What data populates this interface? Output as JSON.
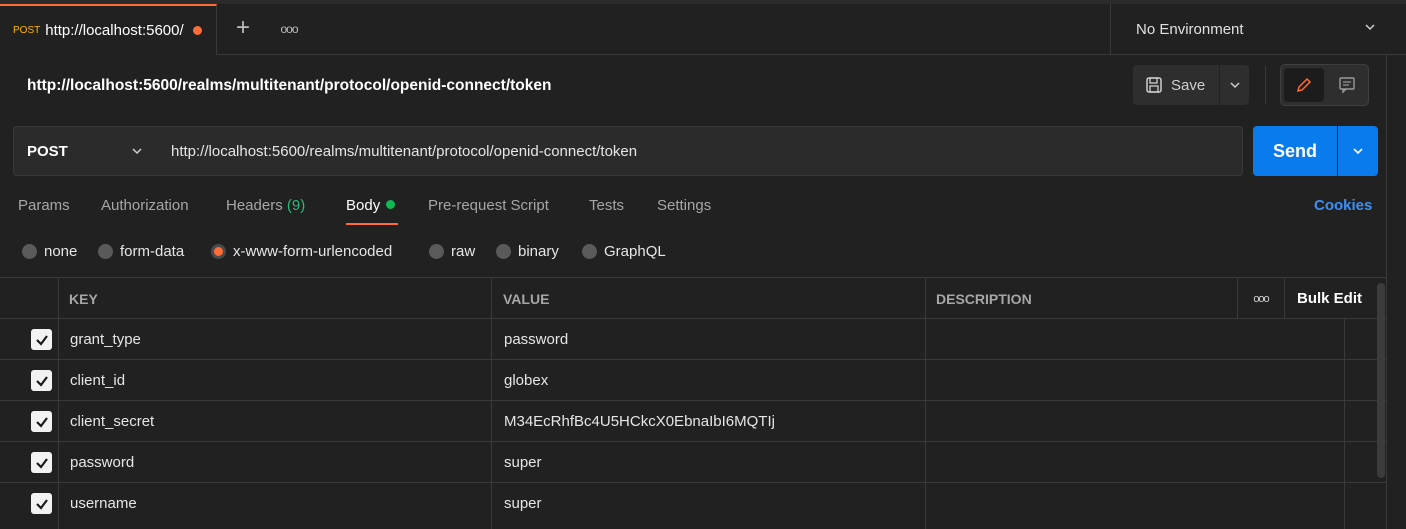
{
  "tab": {
    "method": "POST",
    "url": "http://localhost:5600/",
    "unsaved": true
  },
  "environment": {
    "label": "No Environment"
  },
  "request": {
    "title": "http://localhost:5600/realms/multitenant/protocol/openid-connect/token",
    "method": "POST",
    "url": "http://localhost:5600/realms/multitenant/protocol/openid-connect/token",
    "save_label": "Save",
    "send_label": "Send"
  },
  "request_tabs": {
    "params": "Params",
    "authorization": "Authorization",
    "headers": "Headers",
    "headers_count": "(9)",
    "body": "Body",
    "prerequest": "Pre-request Script",
    "tests": "Tests",
    "settings": "Settings",
    "cookies": "Cookies"
  },
  "body_types": {
    "none": "none",
    "form_data": "form-data",
    "urlencoded": "x-www-form-urlencoded",
    "raw": "raw",
    "binary": "binary",
    "graphql": "GraphQL",
    "selected": "x-www-form-urlencoded"
  },
  "table": {
    "headers": {
      "key": "KEY",
      "value": "VALUE",
      "description": "DESCRIPTION",
      "bulk_edit": "Bulk Edit"
    },
    "rows": [
      {
        "enabled": true,
        "key": "grant_type",
        "value": "password",
        "description": ""
      },
      {
        "enabled": true,
        "key": "client_id",
        "value": "globex",
        "description": ""
      },
      {
        "enabled": true,
        "key": "client_secret",
        "value": "M34EcRhfBc4U5HCkcX0EbnaIbI6MQTIj",
        "description": ""
      },
      {
        "enabled": true,
        "key": "password",
        "value": "super",
        "description": ""
      },
      {
        "enabled": true,
        "key": "username",
        "value": "super",
        "description": ""
      }
    ]
  },
  "colors": {
    "accent": "#ff6c37",
    "send": "#097bed",
    "cookies": "#3d8ff4",
    "body_dot": "#0cbb52"
  }
}
